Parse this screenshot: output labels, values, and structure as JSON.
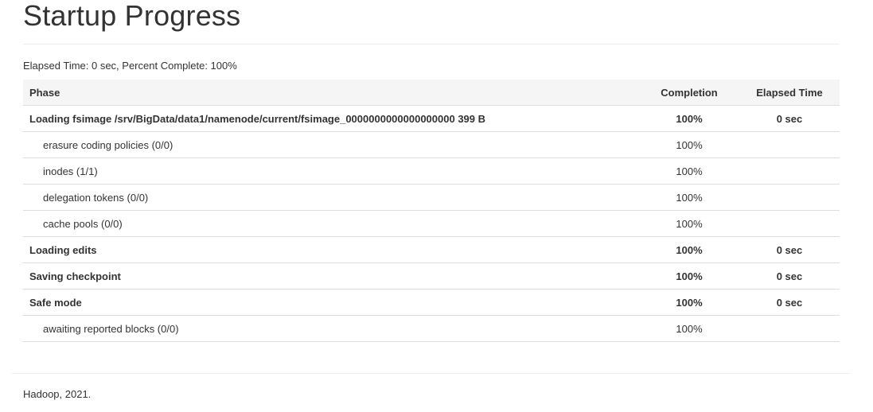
{
  "page": {
    "title": "Startup Progress"
  },
  "summary": {
    "text": "Elapsed Time: 0 sec, Percent Complete: 100%"
  },
  "table": {
    "headers": {
      "phase": "Phase",
      "completion": "Completion",
      "elapsed": "Elapsed Time"
    },
    "rows": [
      {
        "kind": "phase",
        "phase": "Loading fsimage /srv/BigData/data1/namenode/current/fsimage_0000000000000000000 399 B",
        "completion": "100%",
        "elapsed": "0 sec"
      },
      {
        "kind": "step",
        "phase": "erasure coding policies (0/0)",
        "completion": "100%",
        "elapsed": ""
      },
      {
        "kind": "step",
        "phase": "inodes (1/1)",
        "completion": "100%",
        "elapsed": ""
      },
      {
        "kind": "step",
        "phase": "delegation tokens (0/0)",
        "completion": "100%",
        "elapsed": ""
      },
      {
        "kind": "step",
        "phase": "cache pools (0/0)",
        "completion": "100%",
        "elapsed": ""
      },
      {
        "kind": "phase",
        "phase": "Loading edits",
        "completion": "100%",
        "elapsed": "0 sec"
      },
      {
        "kind": "phase",
        "phase": "Saving checkpoint",
        "completion": "100%",
        "elapsed": "0 sec"
      },
      {
        "kind": "phase",
        "phase": "Safe mode",
        "completion": "100%",
        "elapsed": "0 sec"
      },
      {
        "kind": "step",
        "phase": "awaiting reported blocks (0/0)",
        "completion": "100%",
        "elapsed": ""
      }
    ]
  },
  "footer": {
    "text": "Hadoop, 2021."
  }
}
